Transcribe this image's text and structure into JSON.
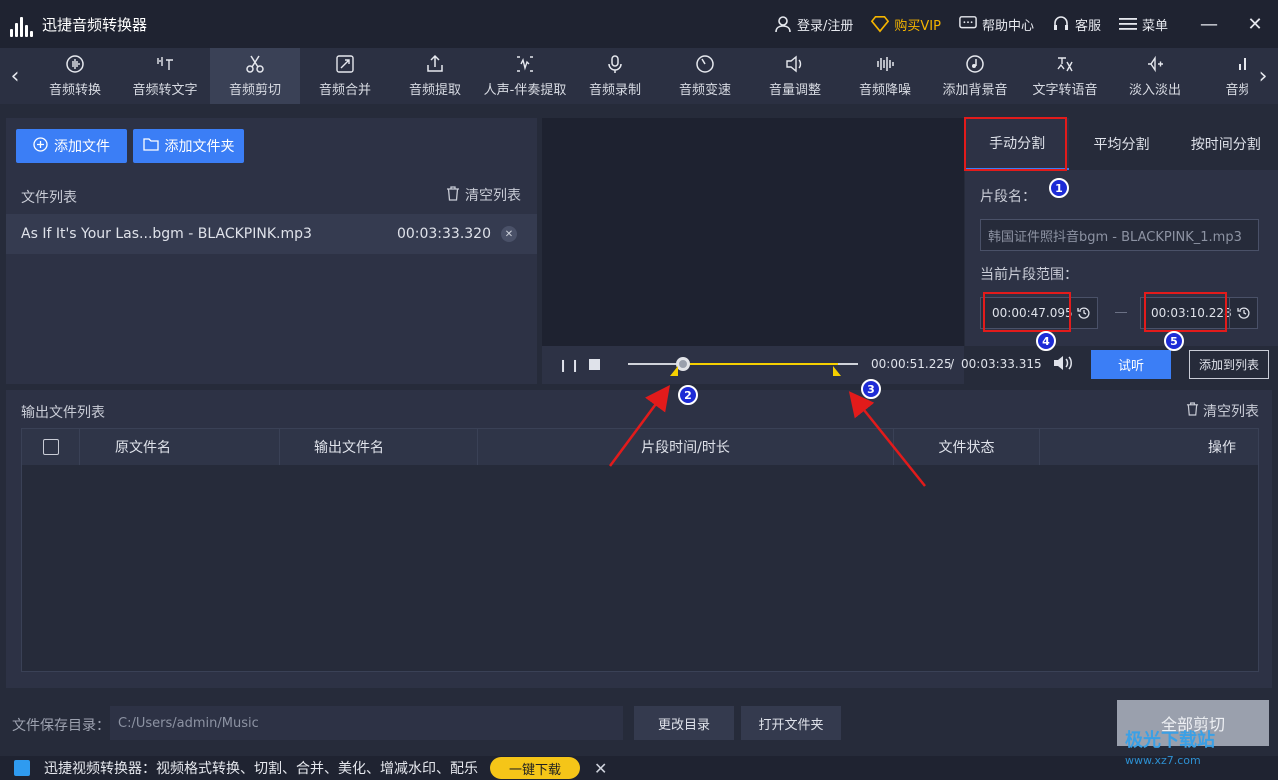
{
  "app": {
    "title": "迅捷音频转换器",
    "login": "登录/注册",
    "vip": "购买VIP",
    "help": "帮助中心",
    "service": "客服",
    "menu": "菜单"
  },
  "tools": [
    {
      "label": "音频转换",
      "icon": "waveform-circle-icon"
    },
    {
      "label": "音频转文字",
      "icon": "text-convert-icon"
    },
    {
      "label": "音频剪切",
      "icon": "scissors-icon"
    },
    {
      "label": "音频合并",
      "icon": "merge-icon"
    },
    {
      "label": "音频提取",
      "icon": "upload-icon"
    },
    {
      "label": "人声-伴奏提取",
      "icon": "separate-icon"
    },
    {
      "label": "音频录制",
      "icon": "microphone-icon"
    },
    {
      "label": "音频变速",
      "icon": "speed-icon"
    },
    {
      "label": "音量调整",
      "icon": "volume-icon"
    },
    {
      "label": "音频降噪",
      "icon": "denoise-icon"
    },
    {
      "label": "添加背景音",
      "icon": "music-disc-icon"
    },
    {
      "label": "文字转语音",
      "icon": "tts-icon"
    },
    {
      "label": "淡入淡出",
      "icon": "fade-icon"
    },
    {
      "label": "音频采",
      "icon": "bars-icon"
    }
  ],
  "active_tool_index": 2,
  "left": {
    "add_file": "添加文件",
    "add_folder": "添加文件夹",
    "file_list": "文件列表",
    "clear_list": "清空列表",
    "files": [
      {
        "name": "As If It's Your Las...bgm - BLACKPINK.mp3",
        "duration": "00:03:33.320"
      }
    ]
  },
  "player": {
    "current": "00:00:51.225",
    "separator": "/",
    "total": "00:03:33.315",
    "trial": "试听",
    "add_to_list": "添加到列表"
  },
  "split": {
    "tabs": [
      "手动分割",
      "平均分割",
      "按时间分割"
    ],
    "segment_name_label": "片段名：",
    "segment_name_value": "韩国证件照抖音bgm - BLACKPINK_1.mp3",
    "range_label": "当前片段范围：",
    "range_start": "00:00:47.095",
    "range_end": "00:03:10.228"
  },
  "output": {
    "title": "输出文件列表",
    "clear": "清空列表",
    "columns": [
      "原文件名",
      "输出文件名",
      "片段时间/时长",
      "文件状态",
      "操作"
    ]
  },
  "bottom": {
    "save_label": "文件保存目录：",
    "save_path": "C:/Users/admin/Music",
    "change_dir": "更改目录",
    "open_folder": "打开文件夹",
    "cut_all": "全部剪切"
  },
  "promo": {
    "text": "迅捷视频转换器：视频格式转换、切割、合并、美化、增减水印、配乐",
    "download": "一键下载"
  },
  "badges": [
    "1",
    "2",
    "3",
    "4",
    "5"
  ],
  "watermark": {
    "title": "极光下载站",
    "url": "www.xz7.com"
  },
  "colors": {
    "accent": "#3b7ef6",
    "highlight": "#f5d000",
    "annotation": "#e21b1b"
  }
}
